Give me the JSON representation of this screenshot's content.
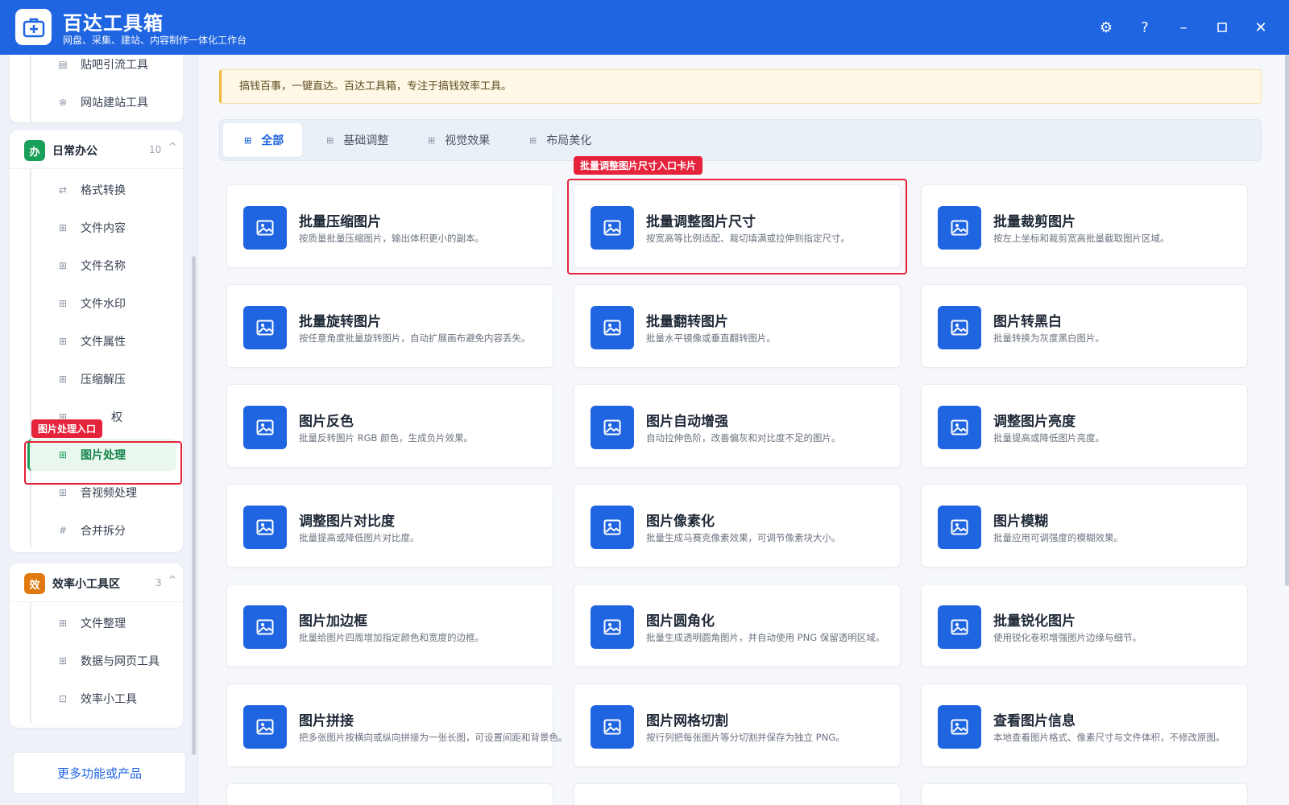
{
  "app": {
    "title": "百达工具箱",
    "subtitle": "网盘、采集、建站、内容制作一体化工作台",
    "logo_icon": "toolbox-icon"
  },
  "window_controls": [
    "gear-icon",
    "help-icon",
    "minimize-icon",
    "maximize-icon",
    "close-icon"
  ],
  "sidebar": {
    "top_items": [
      {
        "label": "贴吧引流工具",
        "icon": "doc-icon"
      },
      {
        "label": "网站建站工具",
        "icon": "globe-icon"
      }
    ],
    "groups": [
      {
        "badge": "办",
        "badge_color": "#18a058",
        "title": "日常办公",
        "count": "10",
        "items": [
          {
            "label": "格式转换",
            "icon": "swap-icon"
          },
          {
            "label": "文件内容",
            "icon": "grid-icon"
          },
          {
            "label": "文件名称",
            "icon": "grid-icon"
          },
          {
            "label": "文件水印",
            "icon": "grid-icon"
          },
          {
            "label": "文件属性",
            "icon": "grid-icon"
          },
          {
            "label": "压缩解压",
            "icon": "grid-icon"
          },
          {
            "label": "权",
            "icon": "grid-icon"
          },
          {
            "label": "图片处理",
            "icon": "grid-icon"
          },
          {
            "label": "音视频处理",
            "icon": "grid-icon"
          },
          {
            "label": "合并拆分",
            "icon": "hash-icon"
          }
        ]
      },
      {
        "badge": "效",
        "badge_color": "#e07a10",
        "title": "效率小工具区",
        "count": "3",
        "items": [
          {
            "label": "文件整理",
            "icon": "grid-icon"
          },
          {
            "label": "数据与网页工具",
            "icon": "grid-icon"
          },
          {
            "label": "效率小工具",
            "icon": "box-icon"
          }
        ]
      }
    ],
    "more_label": "更多功能或产品",
    "entry_tag": "图片处理入口"
  },
  "notice": "搞钱百事，一键直达。百达工具箱，专注于搞钱效率工具。",
  "tabs": [
    "全部",
    "基础调整",
    "视觉效果",
    "布局美化"
  ],
  "card_tag": "批量调整图片尺寸入口卡片",
  "cards": [
    {
      "title": "批量压缩图片",
      "desc": "按质量批量压缩图片，输出体积更小的副本。"
    },
    {
      "title": "批量调整图片尺寸",
      "desc": "按宽高等比例适配、裁切填满或拉伸到指定尺寸。"
    },
    {
      "title": "批量裁剪图片",
      "desc": "按左上坐标和裁剪宽高批量截取图片区域。"
    },
    {
      "title": "批量旋转图片",
      "desc": "按任意角度批量旋转图片，自动扩展画布避免内容丢失。"
    },
    {
      "title": "批量翻转图片",
      "desc": "批量水平镜像或垂直翻转图片。"
    },
    {
      "title": "图片转黑白",
      "desc": "批量转换为灰度黑白图片。"
    },
    {
      "title": "图片反色",
      "desc": "批量反转图片 RGB 颜色，生成负片效果。"
    },
    {
      "title": "图片自动增强",
      "desc": "自动拉伸色阶，改善偏灰和对比度不足的图片。"
    },
    {
      "title": "调整图片亮度",
      "desc": "批量提高或降低图片亮度。"
    },
    {
      "title": "调整图片对比度",
      "desc": "批量提高或降低图片对比度。"
    },
    {
      "title": "图片像素化",
      "desc": "批量生成马赛克像素效果，可调节像素块大小。"
    },
    {
      "title": "图片模糊",
      "desc": "批量应用可调强度的模糊效果。"
    },
    {
      "title": "图片加边框",
      "desc": "批量给图片四周增加指定颜色和宽度的边框。"
    },
    {
      "title": "图片圆角化",
      "desc": "批量生成透明圆角图片，并自动使用 PNG 保留透明区域。"
    },
    {
      "title": "批量锐化图片",
      "desc": "使用锐化卷积增强图片边缘与细节。"
    },
    {
      "title": "图片拼接",
      "desc": "把多张图片按横向或纵向拼接为一张长图，可设置间距和背景色。"
    },
    {
      "title": "图片网格切割",
      "desc": "按行列把每张图片等分切割并保存为独立 PNG。"
    },
    {
      "title": "查看图片信息",
      "desc": "本地查看图片格式、像素尺寸与文件体积，不修改原图。"
    }
  ]
}
